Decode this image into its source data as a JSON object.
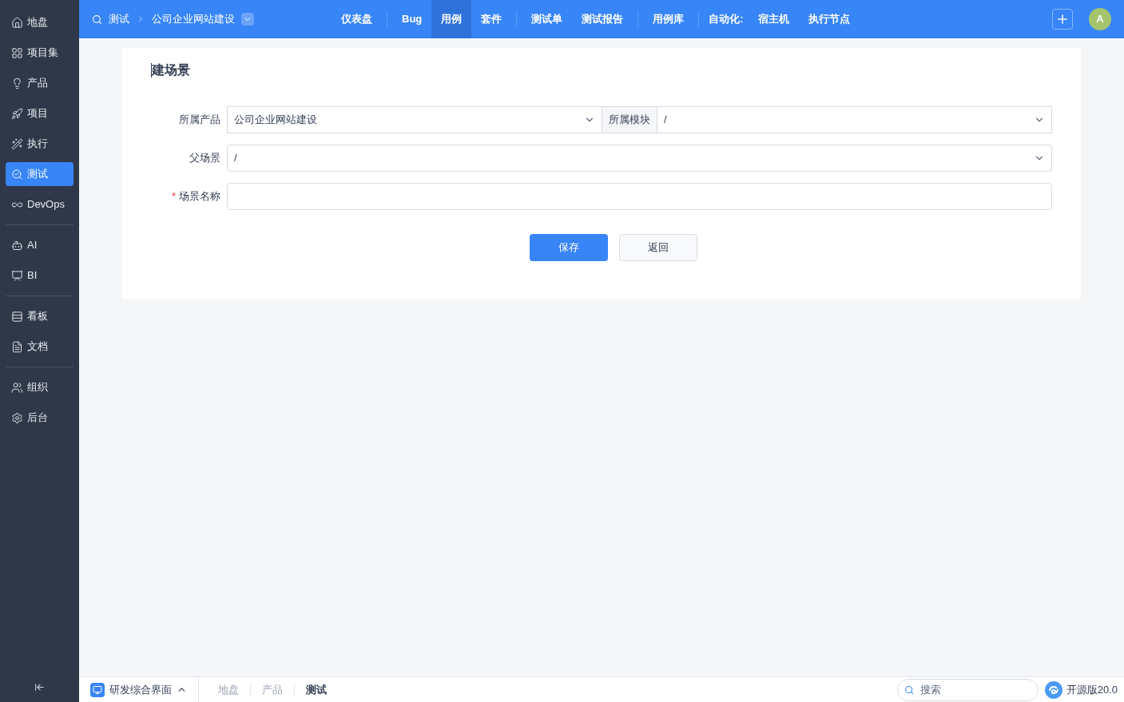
{
  "sidebar": {
    "groups": [
      [
        {
          "label": "地盘",
          "selected": false
        },
        {
          "label": "项目集",
          "selected": false
        },
        {
          "label": "产品",
          "selected": false
        },
        {
          "label": "项目",
          "selected": false
        },
        {
          "label": "执行",
          "selected": false
        },
        {
          "label": "测试",
          "selected": true
        },
        {
          "label": "DevOps",
          "selected": false
        }
      ],
      [
        {
          "label": "AI",
          "selected": false
        },
        {
          "label": "BI",
          "selected": false
        }
      ],
      [
        {
          "label": "看板",
          "selected": false
        },
        {
          "label": "文档",
          "selected": false
        }
      ],
      [
        {
          "label": "组织",
          "selected": false
        },
        {
          "label": "后台",
          "selected": false
        }
      ]
    ]
  },
  "header": {
    "breadcrumb": [
      "测试",
      "公司企业网站建设"
    ],
    "nav_groups": [
      [
        {
          "kind": "link",
          "label": "仪表盘",
          "selected": false
        }
      ],
      [
        {
          "kind": "link",
          "label": "Bug",
          "selected": false
        },
        {
          "kind": "link",
          "label": "用例",
          "selected": true
        },
        {
          "kind": "link",
          "label": "套件",
          "selected": false
        }
      ],
      [
        {
          "kind": "link",
          "label": "测试单",
          "selected": false
        },
        {
          "kind": "link",
          "label": "测试报告",
          "selected": false
        }
      ],
      [
        {
          "kind": "link",
          "label": "用例库",
          "selected": false
        }
      ],
      [
        {
          "kind": "label",
          "label": "自动化:"
        },
        {
          "kind": "link",
          "label": "宿主机",
          "selected": false
        },
        {
          "kind": "link",
          "label": "执行节点",
          "selected": false
        }
      ]
    ],
    "avatar": "A"
  },
  "form": {
    "title": "建场景",
    "product": {
      "label": "所属产品",
      "value": "公司企业网站建设"
    },
    "module": {
      "label": "所属模块",
      "value": "/"
    },
    "parent": {
      "label": "父场景",
      "value": "/"
    },
    "name": {
      "label": "场景名称",
      "required": true,
      "required_mark": "*"
    },
    "buttons": [
      {
        "kind": "primary",
        "label": "保存"
      },
      {
        "kind": "secondary",
        "label": "返回"
      }
    ]
  },
  "bottom_bar": {
    "app": "研发综合界面",
    "breadcrumb": [
      {
        "label": "地盘",
        "selected": false
      },
      {
        "label": "产品",
        "selected": false
      },
      {
        "label": "测试",
        "selected": true
      }
    ],
    "search": {
      "placeholder": "搜索"
    },
    "version": "开源版20.0"
  }
}
